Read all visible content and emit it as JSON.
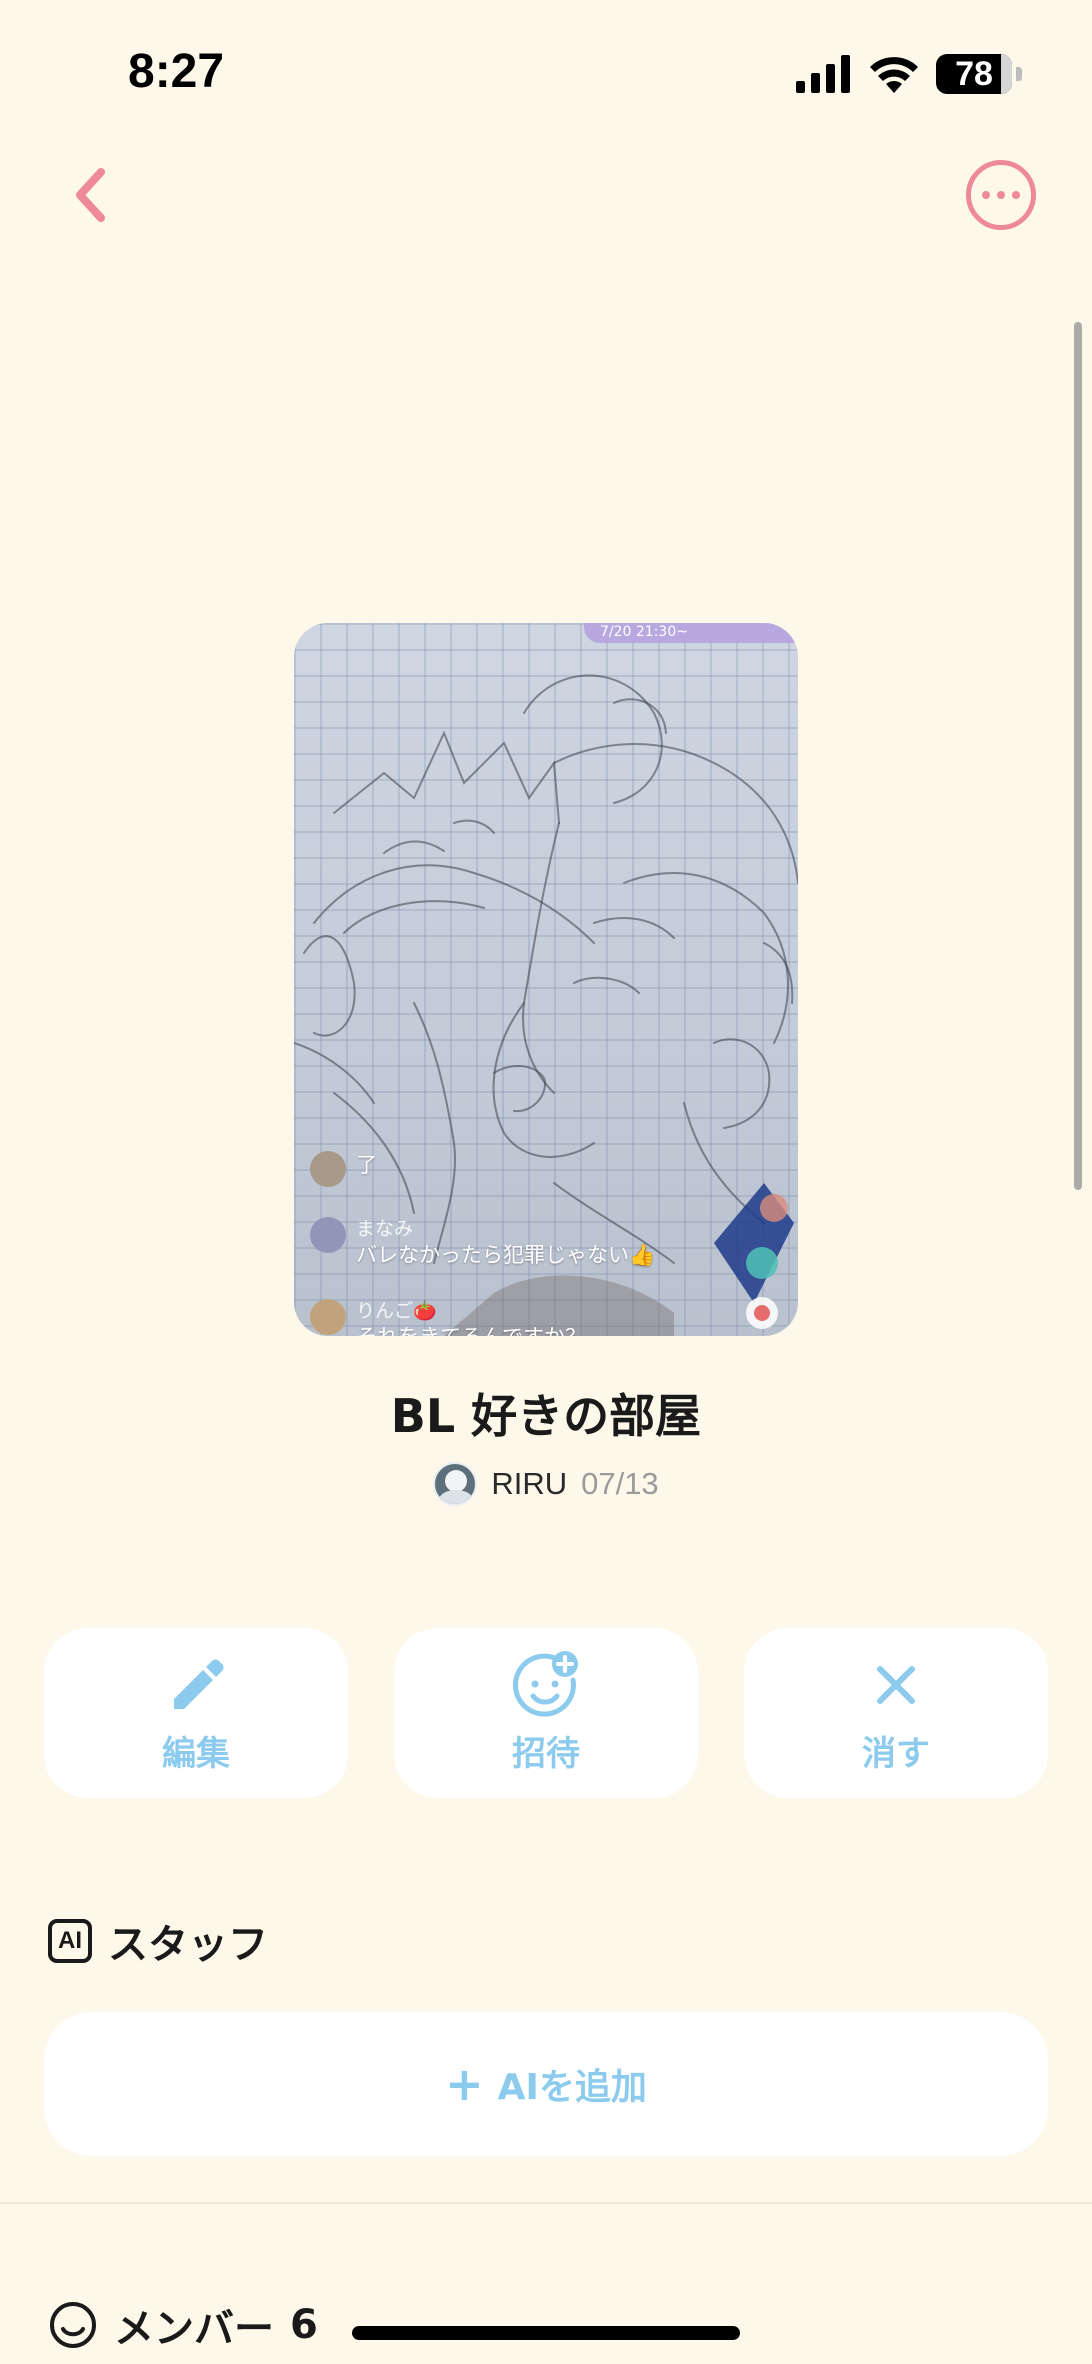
{
  "status_bar": {
    "time": "8:27",
    "battery": "78"
  },
  "nav": {
    "back_icon": "chevron-left-icon",
    "more_icon": "ellipsis-circle-icon"
  },
  "cover": {
    "banner_text": "7/20 21:30~",
    "comments": [
      {
        "name": "",
        "text": "了"
      },
      {
        "name": "まなみ",
        "text": "バレなかったら犯罪じゃない👍"
      },
      {
        "name": "りんご🍅",
        "text": "それをきてるんですか？"
      }
    ]
  },
  "room": {
    "title": "BL 好きの部屋",
    "owner_name": "RIRU",
    "date": "07/13"
  },
  "actions": [
    {
      "label": "編集",
      "icon": "pencil-icon"
    },
    {
      "label": "招待",
      "icon": "add-person-icon"
    },
    {
      "label": "消す",
      "icon": "close-icon"
    }
  ],
  "staff": {
    "heading": "スタッフ",
    "badge": "AI",
    "add_button": "AIを追加"
  },
  "members": {
    "heading": "メンバー",
    "count": "6"
  },
  "colors": {
    "background": "#FEF8EA",
    "accent_pink": "#EE8A98",
    "accent_blue": "#8DCBEE",
    "card": "#FFFFFF"
  }
}
